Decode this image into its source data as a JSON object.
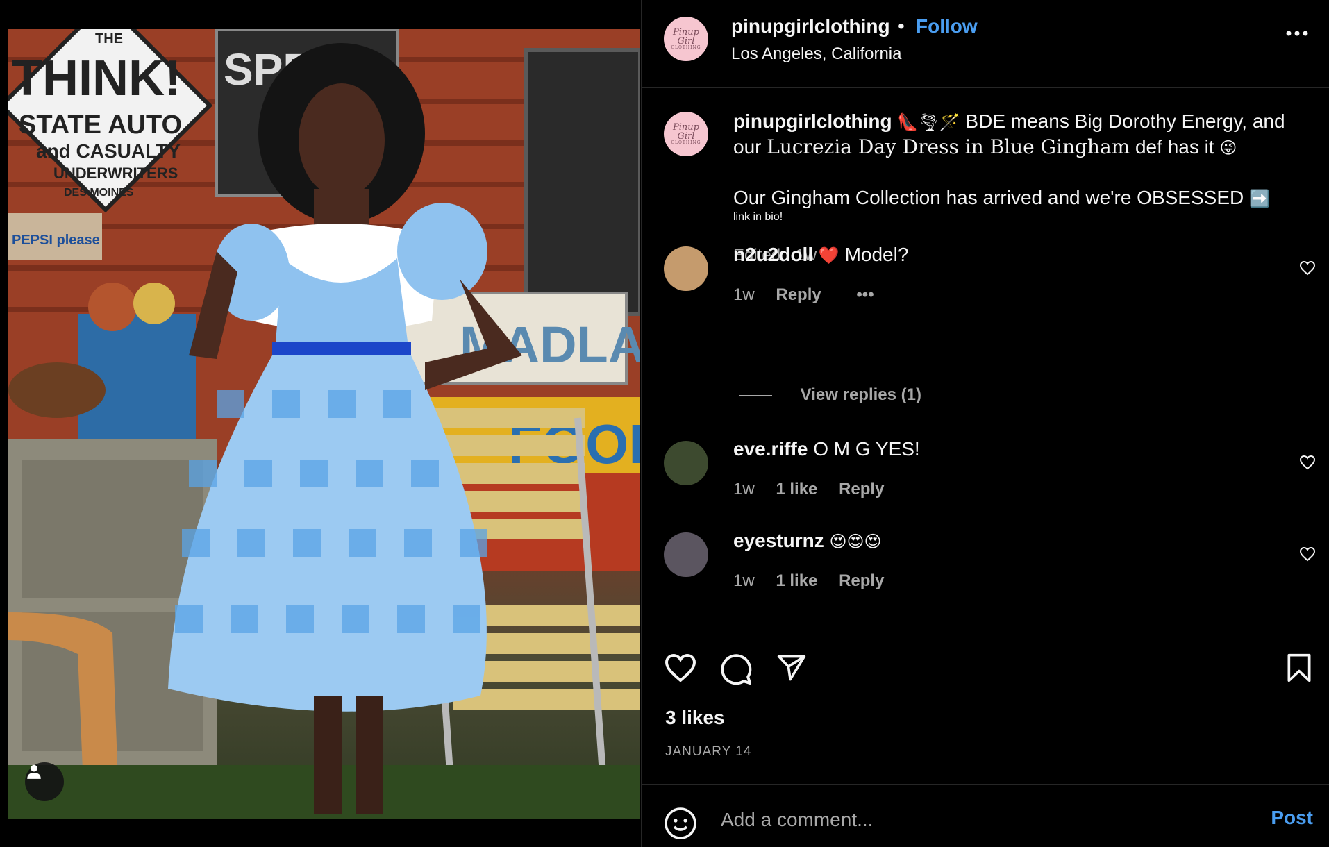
{
  "post": {
    "username": "pinupgirlclothing",
    "follow_label": "Follow",
    "separator": "•",
    "location": "Los Angeles, California",
    "avatar_text": "Pinup Girl",
    "avatar_subtext": "CLOTHING",
    "photo_sign_text": "THINK! STATE AUTO and CASUALTY UNDERWRITERS DES MOINES",
    "photo_sign_small": "THE",
    "photo_madla_text": "MADLA",
    "photo_food_text": "FOOD",
    "photo_pepsi_text": "PEPSI please",
    "photo_speed_text": "SPEE"
  },
  "caption": {
    "username": "pinupgirlclothing",
    "emojis": "👠🌪🪄",
    "text_1": "BDE means Big Dorothy Energy, and",
    "text_2_pre": "our",
    "text_2_fancy": "Lucrezia Day Dress in Blue Gingham",
    "text_2_post": "def has it",
    "emoji_wink": "😜",
    "text_3": "Our Gingham Collection has arrived and we're OBSESSED",
    "emoji_arrow": "➡️",
    "text_4": "link in bio!",
    "edited": "Edited · 1w"
  },
  "comments": [
    {
      "username": "n2u2doll",
      "emoji": "❤️",
      "text": "Model?",
      "time": "1w",
      "likes": "",
      "reply": "Reply",
      "more": "•••",
      "view_replies": "View replies (1)"
    },
    {
      "username": "eve.riffe",
      "text": "O M G YES!",
      "time": "1w",
      "likes": "1 like",
      "reply": "Reply"
    },
    {
      "username": "eyesturnz",
      "text": "😍😍😍",
      "time": "1w",
      "likes": "1 like",
      "reply": "Reply"
    }
  ],
  "actions": {
    "likes": "3 likes",
    "date": "JANUARY 14"
  },
  "add_comment": {
    "placeholder": "Add a comment...",
    "post_label": "Post"
  },
  "colors": {
    "background": "#000000",
    "text": "#f5f5f5",
    "muted": "#a8a8a8",
    "link": "#4a9df0",
    "divider": "#262626"
  }
}
